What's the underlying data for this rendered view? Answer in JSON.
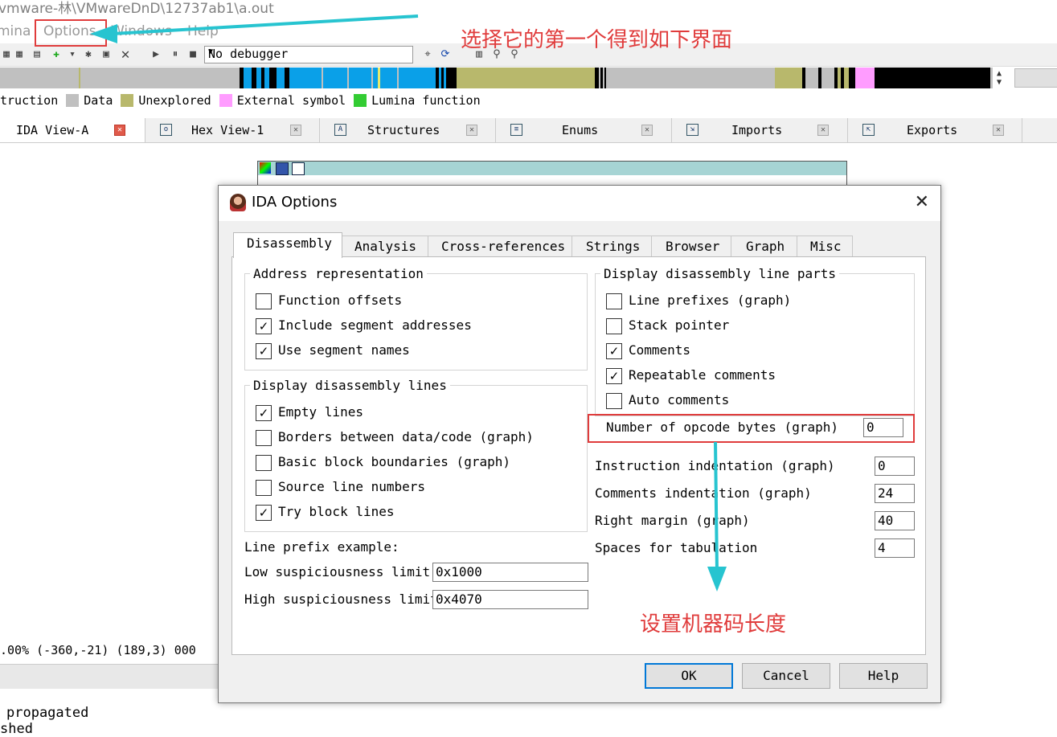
{
  "window": {
    "title": "vmware-林\\VMwareDnD\\12737ab1\\a.out"
  },
  "menu": {
    "items": [
      "mina",
      "Options",
      "Windows",
      "Help"
    ]
  },
  "toolbar": {
    "debugger_value": "No debugger"
  },
  "legend": {
    "items": [
      {
        "label": "truction",
        "color": ""
      },
      {
        "label": "Data",
        "color": "#c0c0c0"
      },
      {
        "label": "Unexplored",
        "color": "#b8b86c"
      },
      {
        "label": "External symbol",
        "color": "#ff9cff"
      },
      {
        "label": "Lumina function",
        "color": "#33cc33"
      }
    ]
  },
  "ida_tabs": [
    {
      "label": "IDA View-A",
      "active": true
    },
    {
      "label": "Hex View-1",
      "active": false
    },
    {
      "label": "Structures",
      "active": false
    },
    {
      "label": "Enums",
      "active": false
    },
    {
      "label": "Imports",
      "active": false
    },
    {
      "label": "Exports",
      "active": false
    }
  ],
  "status": {
    "line": ".00% (-360,-21) (189,3) 000",
    "output1": "propagated",
    "output2": "shed"
  },
  "dialog": {
    "title": "IDA Options",
    "tabs": [
      "Disassembly",
      "Analysis",
      "Cross-references",
      "Strings",
      "Browser",
      "Graph",
      "Misc"
    ],
    "address_group": {
      "title": "Address representation",
      "options": [
        {
          "label": "Function offsets",
          "checked": false
        },
        {
          "label": "Include segment addresses",
          "checked": true
        },
        {
          "label": "Use segment names",
          "checked": true
        }
      ]
    },
    "lines_group": {
      "title": "Display disassembly lines",
      "options": [
        {
          "label": "Empty lines",
          "checked": true
        },
        {
          "label": "Borders between data/code (graph)",
          "checked": false
        },
        {
          "label": "Basic block boundaries (graph)",
          "checked": false
        },
        {
          "label": "Source line numbers",
          "checked": false
        },
        {
          "label": "Try block lines",
          "checked": true
        }
      ]
    },
    "line_prefix_example": "Line prefix example:",
    "low_susp": {
      "label": "Low suspiciousness limit",
      "value": "0x1000"
    },
    "high_susp": {
      "label": "High suspiciousness limit",
      "value": "0x4070"
    },
    "parts_group": {
      "title": "Display disassembly line parts",
      "options": [
        {
          "label": "Line prefixes (graph)",
          "checked": false
        },
        {
          "label": "Stack pointer",
          "checked": false
        },
        {
          "label": "Comments",
          "checked": true
        },
        {
          "label": "Repeatable comments",
          "checked": true
        },
        {
          "label": "Auto comments",
          "checked": false
        }
      ]
    },
    "opcode_bytes": {
      "label": "Number of opcode bytes (graph)",
      "value": "0"
    },
    "instr_indent": {
      "label": "Instruction indentation (graph)",
      "value": "0"
    },
    "comments_indent": {
      "label": "Comments indentation (graph)",
      "value": "24"
    },
    "right_margin": {
      "label": "Right margin (graph)",
      "value": "40"
    },
    "spaces_tab": {
      "label": "Spaces for tabulation",
      "value": "4"
    },
    "buttons": {
      "ok": "OK",
      "cancel": "Cancel",
      "help": "Help"
    }
  },
  "annotations": {
    "top_note": "选择它的第一个得到如下界面",
    "bottom_note": "设置机器码长度",
    "color": "#e03c3c",
    "arrow_color": "#27c4d0"
  }
}
